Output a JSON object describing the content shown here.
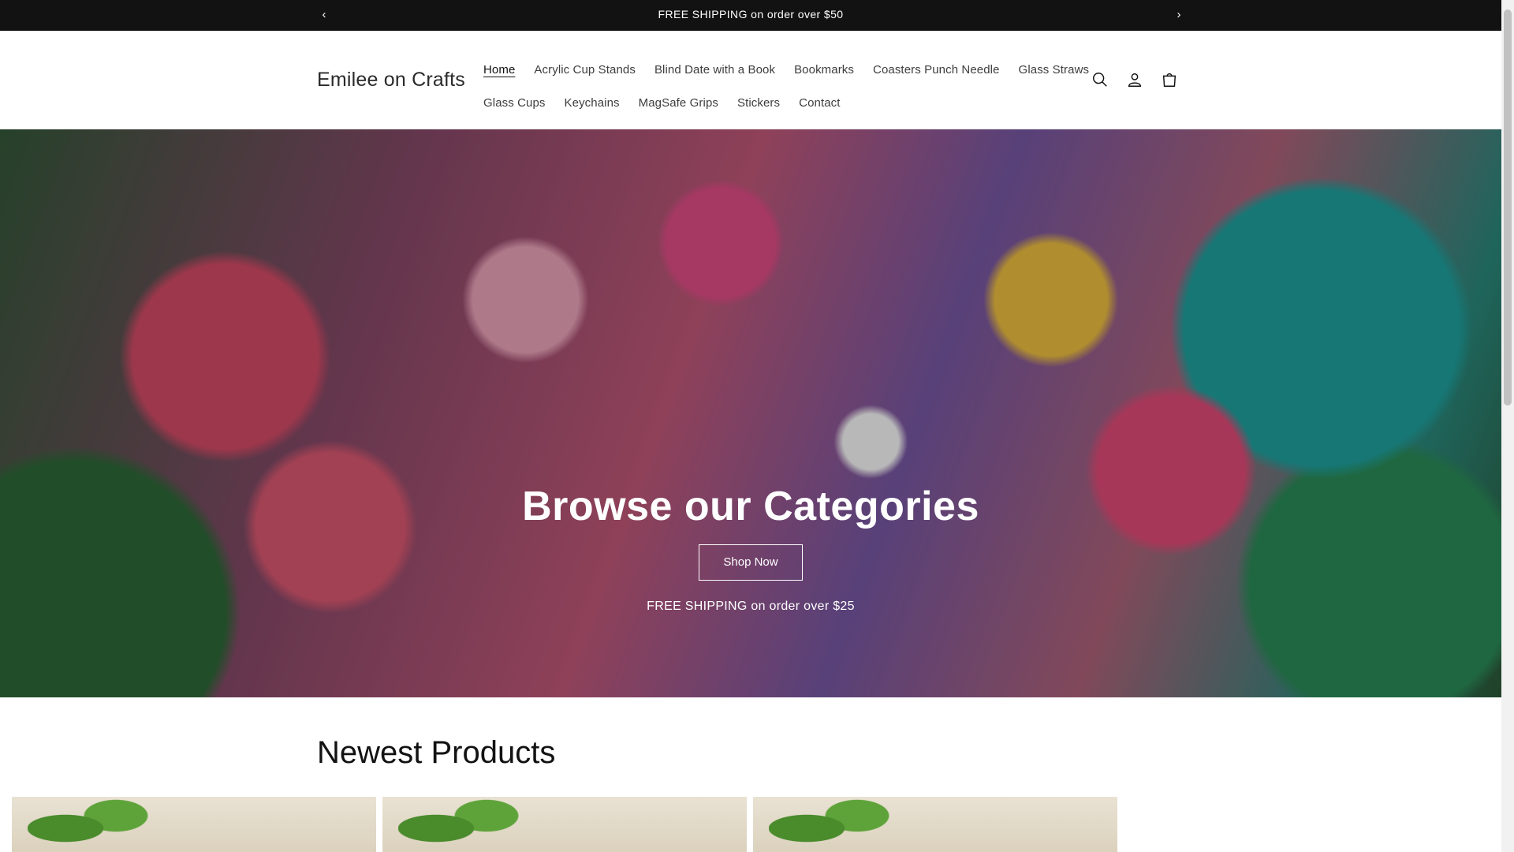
{
  "announcement": {
    "message": "FREE SHIPPING on order over $50",
    "prev_icon": "chevron-left-icon",
    "next_icon": "chevron-right-icon"
  },
  "header": {
    "logo": "Emilee on Crafts",
    "nav_row1": [
      "Home",
      "Acrylic Cup Stands",
      "Blind Date with a Book",
      "Bookmarks",
      "Coasters Punch Needle",
      "Glass Straws"
    ],
    "nav_row2": [
      "Glass Cups",
      "Keychains",
      "MagSafe Grips",
      "Stickers",
      "Contact"
    ],
    "active_nav": "Home",
    "icons": [
      "search-icon",
      "account-icon",
      "cart-icon"
    ]
  },
  "hero": {
    "title": "Browse our Categories",
    "button_label": "Shop Now",
    "subtitle": "FREE SHIPPING on order over $25"
  },
  "newest": {
    "title": "Newest Products"
  },
  "colors": {
    "announcement_bg": "#121212",
    "text": "#121212",
    "background": "#ffffff"
  }
}
